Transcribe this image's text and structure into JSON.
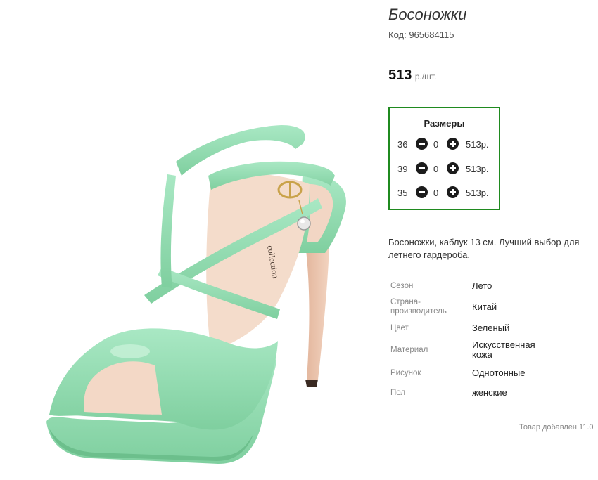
{
  "product": {
    "title": "Босоножки",
    "code": "Код: 965684115",
    "price_value": "513",
    "price_unit": "р./шт.",
    "description": "Босоножки, каблук 13 см. Лучший выбор для летнего гардероба.",
    "added_note": "Товар добавлен 11.0"
  },
  "sizes": {
    "title": "Размеры",
    "rows": [
      {
        "size": "36",
        "qty": "0",
        "price": "513р."
      },
      {
        "size": "39",
        "qty": "0",
        "price": "513р."
      },
      {
        "size": "35",
        "qty": "0",
        "price": "513р."
      }
    ]
  },
  "specs": [
    {
      "label": "Сезон",
      "value": "Лето"
    },
    {
      "label": "Страна-производитель",
      "value": "Китай"
    },
    {
      "label": "Цвет",
      "value": "Зеленый"
    },
    {
      "label": "Материал",
      "value": "Искусственная кожа"
    },
    {
      "label": "Рисунок",
      "value": "Однотонные"
    },
    {
      "label": "Пол",
      "value": "женские"
    }
  ],
  "colors": {
    "accent_border": "#1f8a1f",
    "shoe_green": "#8fdcb0",
    "shoe_inner": "#e9c6ae"
  },
  "icons": {
    "minus": "minus-circle-icon",
    "plus": "plus-circle-icon"
  }
}
